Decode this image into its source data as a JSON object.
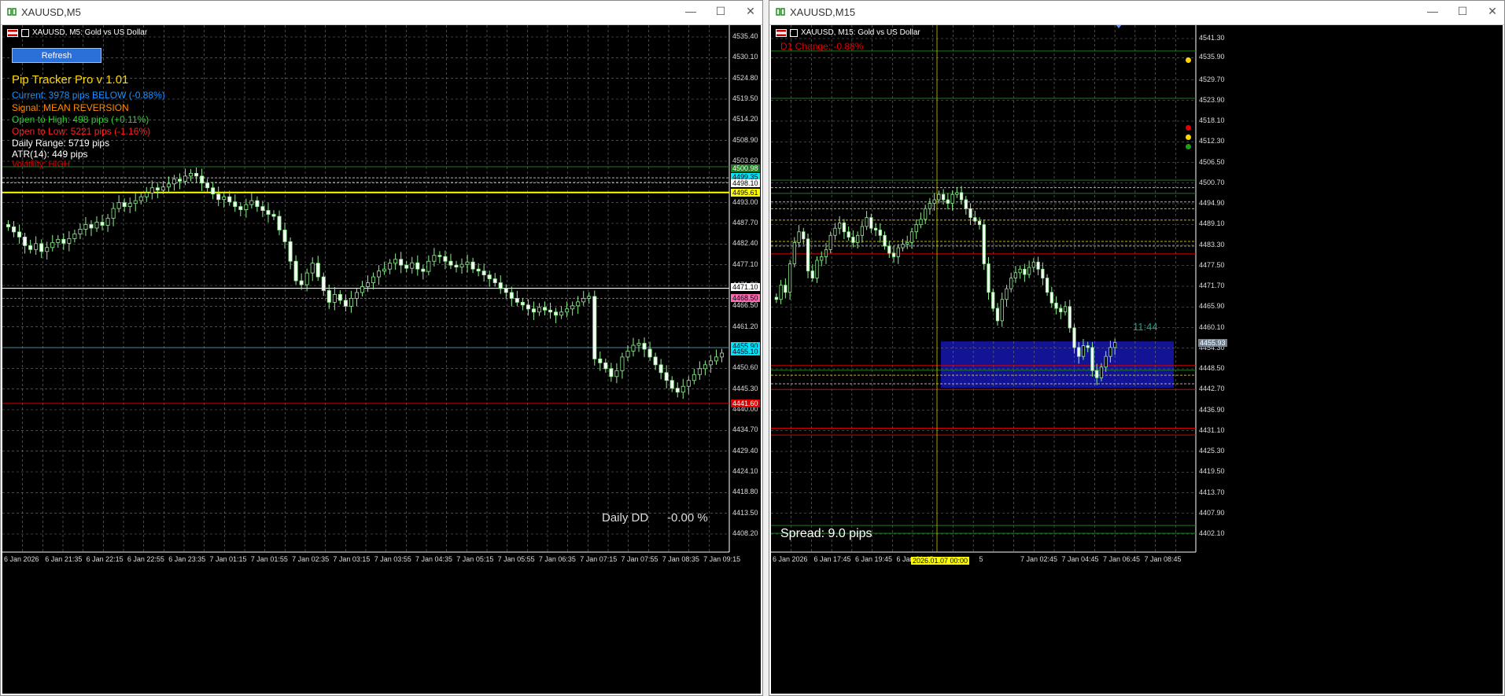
{
  "left": {
    "window_title": "XAUUSD,M5",
    "chart_title": "XAUUSD, M5:  Gold vs US Dollar",
    "refresh_label": "Refresh",
    "panel": {
      "title": "Pip Tracker Pro v 1.01",
      "current": "Current: 3978 pips BELOW (-0.88%)",
      "signal": "Signal: MEAN REVERSION",
      "open_high": "Open to High: 498 pips (+0.11%)",
      "open_low": "Open to Low: 5221 pips (-1.16%)",
      "daily_range": "Daily Range: 5719 pips",
      "atr": "ATR(14): 449 pips",
      "volatility": "Volatility: HIGH"
    },
    "daily_dd_label": "Daily DD",
    "daily_dd_value": "-0.00 %",
    "yticks": [
      "4535.40",
      "4530.10",
      "4524.80",
      "4519.50",
      "4514.20",
      "4508.90",
      "4503.60",
      "4498.30",
      "4493.00",
      "4487.70",
      "4482.40",
      "4477.10",
      "4471.80",
      "4466.50",
      "4461.20",
      "4455.90",
      "4450.60",
      "4445.30",
      "4440.00",
      "4434.70",
      "4429.40",
      "4424.10",
      "4418.80",
      "4413.50",
      "4408.20"
    ],
    "xticks": [
      "6 Jan 2026",
      "6 Jan 21:35",
      "6 Jan 22:15",
      "6 Jan 22:55",
      "6 Jan 23:35",
      "7 Jan 01:15",
      "7 Jan 01:55",
      "7 Jan 02:35",
      "7 Jan 03:15",
      "7 Jan 03:55",
      "7 Jan 04:35",
      "7 Jan 05:15",
      "7 Jan 05:55",
      "7 Jan 06:35",
      "7 Jan 07:15",
      "7 Jan 07:55",
      "7 Jan 08:35",
      "7 Jan 09:15"
    ],
    "price_tags": [
      {
        "value": "4500.98",
        "bg": "#1e7a1e",
        "fg": "#ffffff"
      },
      {
        "value": "4499.35",
        "bg": "#00e5ff",
        "fg": "#000000"
      },
      {
        "value": "4498.10",
        "bg": "#ffffff",
        "fg": "#000000"
      },
      {
        "value": "4495.61",
        "bg": "#ffff00",
        "fg": "#000000"
      },
      {
        "value": "4471.10",
        "bg": "#ffffff",
        "fg": "#000000"
      },
      {
        "value": "4468.50",
        "bg": "#ff69b4",
        "fg": "#000000"
      },
      {
        "value": "4455.90",
        "bg": "#00e5ff",
        "fg": "#000000"
      },
      {
        "value": "4455.10",
        "bg": "#00e5ff",
        "fg": "#000000"
      },
      {
        "value": "4441.60",
        "bg": "#e00000",
        "fg": "#ffffff"
      }
    ],
    "candles": [
      4486.8,
      4485.5,
      4484.2,
      4482.0,
      4481.0,
      4482.5,
      4480.5,
      4481.5,
      4482.8,
      4483.6,
      4482.6,
      4483.8,
      4485.0,
      4486.2,
      4487.4,
      4486.5,
      4488.0,
      4487.2,
      4489.0,
      4491.5,
      4493.0,
      4492.0,
      4492.8,
      4493.5,
      4494.5,
      4495.5,
      4496.8,
      4496.2,
      4497.0,
      4497.8,
      4499.0,
      4498.5,
      4499.8,
      4500.5,
      4499.8,
      4498.0,
      4496.8,
      4495.2,
      4493.8,
      4494.5,
      4493.2,
      4492.0,
      4491.2,
      4492.5,
      4493.5,
      4492.0,
      4491.0,
      4490.0,
      4489.5,
      4486.0,
      4483.0,
      4478.0,
      4473.0,
      4472.0,
      4475.0,
      4477.5,
      4474.0,
      4470.5,
      4467.5,
      4469.5,
      4468.0,
      4466.5,
      4468.5,
      4470.0,
      4471.5,
      4472.5,
      4474.0,
      4475.5,
      4476.0,
      4477.5,
      4478.5,
      4477.0,
      4476.2,
      4477.6,
      4476.0,
      4475.4,
      4478.0,
      4479.5,
      4479.2,
      4478.0,
      4477.0,
      4476.5,
      4477.2,
      4477.8,
      4476.0,
      4475.5,
      4474.5,
      4473.5,
      4472.5,
      4471.0,
      4470.0,
      4468.5,
      4467.5,
      4466.8,
      4465.8,
      4465.0,
      4466.2,
      4465.5,
      4465.0,
      4464.2,
      4465.0,
      4465.8,
      4466.6,
      4467.6,
      4468.5,
      4469.0,
      4453.0,
      4452.0,
      4450.5,
      4448.5,
      4450.0,
      4453.5,
      4455.0,
      4456.5,
      4457.0,
      4455.5,
      4453.5,
      4451.5,
      4449.5,
      4447.5,
      4445.5,
      4444.5,
      4446.0,
      4447.5,
      4449.0,
      4450.5,
      4451.5,
      4452.5,
      4453.5,
      4454.5
    ]
  },
  "right": {
    "window_title": "XAUUSD,M15",
    "chart_title": "XAUUSD, M15:  Gold vs US Dollar",
    "d1_change": "D1 Change:  -0.88%",
    "spread": "Spread:  9.0 pips",
    "clock": "11:44",
    "date_marker": "2026.01.07 00:00",
    "yticks": [
      "4541.30",
      "4535.90",
      "4529.70",
      "4523.90",
      "4518.10",
      "4512.30",
      "4506.50",
      "4500.70",
      "4494.90",
      "4489.10",
      "4483.30",
      "4477.50",
      "4471.70",
      "4465.90",
      "4460.10",
      "4454.30",
      "4448.50",
      "4442.70",
      "4436.90",
      "4431.10",
      "4425.30",
      "4419.50",
      "4413.70",
      "4407.90",
      "4402.10"
    ],
    "xticks": [
      "6 Jan 2026",
      "6 Jan 17:45",
      "6 Jan 19:45",
      "6 Jan 21:45",
      "",
      "5",
      "7 Jan 02:45",
      "7 Jan 04:45",
      "7 Jan 06:45",
      "7 Jan 08:45"
    ],
    "price_tag": {
      "value": "4455.93",
      "bg": "#708090",
      "fg": "#ffffff"
    },
    "candles": [
      4468.0,
      4472.0,
      4470.0,
      4478.0,
      4484.0,
      4487.0,
      4485.0,
      4476.0,
      4474.0,
      4479.0,
      4480.0,
      4482.0,
      4486.0,
      4488.0,
      4489.5,
      4487.0,
      4485.5,
      4484.0,
      4486.0,
      4488.5,
      4491.0,
      4488.0,
      4487.5,
      4486.0,
      4483.0,
      4481.0,
      4480.0,
      4482.5,
      4483.5,
      4484.0,
      4487.0,
      4489.0,
      4490.5,
      4493.5,
      4495.0,
      4496.0,
      4497.5,
      4496.0,
      4495.0,
      4497.5,
      4498.0,
      4496.0,
      4493.5,
      4491.0,
      4490.0,
      4489.0,
      4478.0,
      4470.0,
      4465.5,
      4462.0,
      4468.0,
      4471.0,
      4474.0,
      4475.5,
      4476.5,
      4475.0,
      4477.0,
      4478.5,
      4476.5,
      4474.0,
      4470.0,
      4467.0,
      4465.5,
      4464.5,
      4466.0,
      4460.0,
      4454.5,
      4452.0,
      4455.0,
      4454.5,
      4448.0,
      4446.0,
      4449.0,
      4452.0,
      4454.5,
      4455.9
    ]
  }
}
